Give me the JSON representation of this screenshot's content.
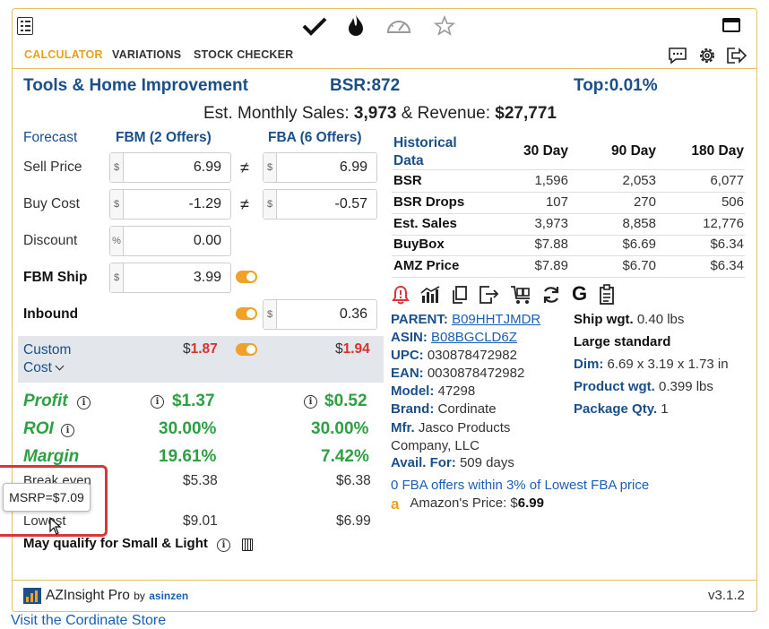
{
  "toolbar": {
    "menu_icon": "list-icon",
    "icons": [
      "checkmark-icon",
      "flame-icon",
      "speedometer-icon",
      "star-icon"
    ],
    "window_icon": "window-icon"
  },
  "tabs": [
    {
      "label": "CALCULATOR",
      "active": true
    },
    {
      "label": "VARIATIONS",
      "active": false
    },
    {
      "label": "STOCK CHECKER",
      "active": false
    }
  ],
  "header": {
    "category": "Tools & Home Improvement",
    "bsr": "BSR:872",
    "top": "Top:0.01%",
    "sales_prefix": "Est. Monthly Sales: ",
    "sales_value": "3,973",
    "sales_mid": " & Revenue: ",
    "revenue_value": "$27,771"
  },
  "calculator": {
    "forecast_label": "Forecast",
    "fbm_header": "FBM (2 Offers)",
    "fba_header": "FBA (6 Offers)",
    "sell_price_label": "Sell Price",
    "buy_cost_label": "Buy Cost",
    "discount_label": "Discount",
    "fbm_ship_label": "FBM Ship",
    "inbound_label": "Inbound",
    "custom_cost_label": "Custom",
    "custom_cost_label2": "Cost",
    "dollar": "$",
    "percent": "%",
    "neq": "≠",
    "fbm_sell_price": "6.99",
    "fba_sell_price": "6.99",
    "fbm_buy_cost": "-1.29",
    "fba_buy_cost": "-0.57",
    "discount": "0.00",
    "fbm_ship": "3.99",
    "inbound": "0.36",
    "fbm_custom_cost": "1.87",
    "fba_custom_cost": "1.94",
    "profit_label": "Profit",
    "fbm_profit": "$1.37",
    "fba_profit": "$0.52",
    "roi_label": "ROI",
    "fbm_roi": "30.00%",
    "fba_roi": "30.00%",
    "margin_label": "Margin",
    "fbm_margin": "19.61%",
    "fba_margin": "7.42%",
    "breakeven_label": "Break even",
    "fbm_breakeven": "$5.38",
    "fba_breakeven": "$6.38",
    "lowest_label": "Lowest",
    "fbm_lowest": "$9.01",
    "fba_lowest": "$6.99",
    "small_light": "May qualify for Small & Light",
    "tooltip": "MSRP=$7.09"
  },
  "historical": {
    "title_line1": "Historical",
    "title_line2": "Data",
    "columns": [
      "30 Day",
      "90 Day",
      "180 Day"
    ],
    "rows": [
      {
        "label": "BSR",
        "values": [
          "1,596",
          "2,053",
          "6,077"
        ]
      },
      {
        "label": "BSR Drops",
        "values": [
          "107",
          "270",
          "506"
        ]
      },
      {
        "label": "Est. Sales",
        "values": [
          "3,973",
          "8,858",
          "12,776"
        ]
      },
      {
        "label": "BuyBox",
        "values": [
          "$7.88",
          "$6.69",
          "$6.34"
        ]
      },
      {
        "label": "AMZ Price",
        "values": [
          "$7.89",
          "$6.70",
          "$6.34"
        ]
      }
    ]
  },
  "action_icons": [
    "alert-bell-icon",
    "chart-icon",
    "copy-icon",
    "export-icon",
    "cart-icon",
    "refresh-icon",
    "google-icon",
    "clipboard-icon"
  ],
  "product": {
    "parent_label": "PARENT:",
    "parent": "B09HHTJMDR",
    "asin_label": "ASIN:",
    "asin": "B08BGCLD6Z",
    "upc_label": "UPC:",
    "upc": "030878472982",
    "ean_label": "EAN:",
    "ean": "0030878472982",
    "model_label": "Model:",
    "model": "47298",
    "brand_label": "Brand:",
    "brand": "Cordinate",
    "mfr_label": "Mfr.",
    "mfr_line1": "Jasco Products",
    "mfr_line2": "Company, LLC",
    "avail_label": "Avail. For:",
    "avail": "509 days",
    "ship_wgt_label": "Ship wgt.",
    "ship_wgt": "0.40 lbs",
    "size_tier": "Large standard",
    "dim_label": "Dim:",
    "dim": "6.69 x 3.19 x 1.73 in",
    "product_wgt_label": "Product wgt.",
    "product_wgt": "0.399 lbs",
    "package_qty_label": "Package Qty.",
    "package_qty": "1",
    "fba_offers": "0 FBA offers within 3% of Lowest FBA price",
    "amazon_price_label": "Amazon's Price: $",
    "amazon_price": "6.99"
  },
  "footer": {
    "brand": "AZInsight Pro",
    "by": "by",
    "company": "asinzen",
    "version": "v3.1.2",
    "visit_link": "Visit the Cordinate Store"
  },
  "colors": {
    "accent": "#e8a21a",
    "brand_blue": "#1a4f8a",
    "profit_green": "#2ea043",
    "custom_red": "#d93030",
    "highlight_red": "#d8373a"
  }
}
